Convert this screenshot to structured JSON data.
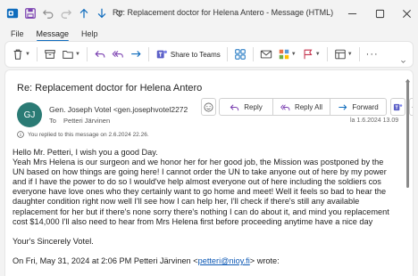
{
  "window": {
    "title": "Re: Replacement doctor for Helena Antero  -  Message (HTML)"
  },
  "menu": {
    "items": [
      "File",
      "Message",
      "Help"
    ],
    "active": "Message"
  },
  "ribbon": {
    "share_label": "Share to Teams"
  },
  "email": {
    "subject": "Re: Replacement doctor for Helena Antero",
    "avatar_initials": "GJ",
    "sender": "Gen. Joseph Votel <gen.josephvotel2272",
    "to_label": "To",
    "to_name": "Petteri Järvinen",
    "date": "la 1.6.2024 13.09",
    "info": "You replied to this message on 2.6.2024 22.26.",
    "actions": {
      "reply": "Reply",
      "reply_all": "Reply All",
      "forward": "Forward"
    },
    "body": {
      "greeting": "Hello Mr. Petteri, I wish you a good Day.",
      "paragraph": "Yeah Mrs Helena is our surgeon and we honor her for her good job, the Mission was postponed by the UN based on how things are going here! I cannot order the UN to take anyone out of here by my power and if I have the power to do so I would've help almost everyone out of here including the soldiers cos everyone have love ones who they certainly want to go home and meet!  Well it feels so bad to hear the daughter condition right now well I'll see how I can help her, I'll check if there's still any available replacement for her but if there's none sorry there's nothing I can do about it, and mind you replacement cost $14,000 I'll also need to hear from Mrs Helena first before proceeding anytime have a nice day",
      "signoff": "Your's Sincerely Votel.",
      "quote_prefix": "On Fri, May 31, 2024 at 2:06 PM Petteri Järvinen <",
      "quote_email": "petteri@nioy.fi",
      "quote_suffix": "> wrote:"
    }
  },
  "colors": {
    "accent": "#0f6cbd",
    "avatar": "#2b7b75",
    "link": "#0b57b4"
  }
}
